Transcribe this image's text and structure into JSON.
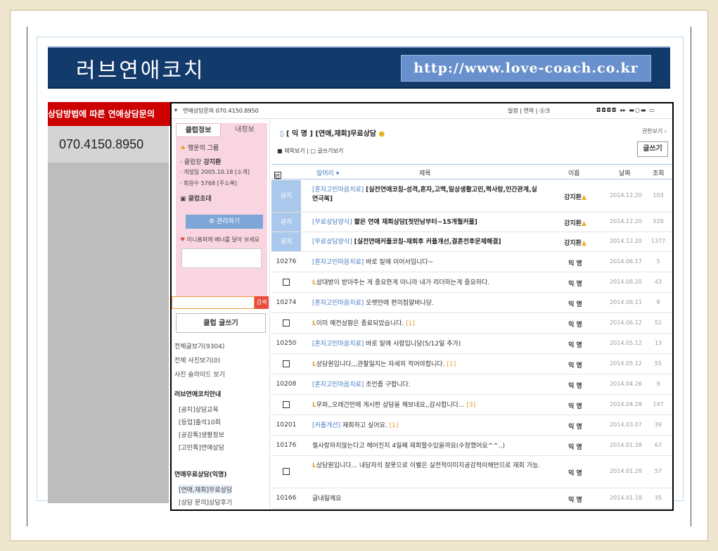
{
  "banner": {
    "title": "러브연애코치",
    "url": "http://www.love-coach.co.kr"
  },
  "left_panel": {
    "red_text": "상담방법에 따른 연애상담문의",
    "phone": "070.4150.8950"
  },
  "topbar": {
    "title": "연애상담문의 070.4150.8950",
    "links": "일정 | 연락 | ⓖ크"
  },
  "sidebar": {
    "tab_info": "클럽정보",
    "tab_mine": "내정보",
    "grade": "행운의 그룹",
    "master_label": "· 클럽장",
    "master_name": "강지환",
    "open_date": "· 개설일   2005.10.18 [소개]",
    "members": "· 회원수   5768 [주소록]",
    "invite": "클럽초대",
    "manage": "⚙ 관리하기",
    "mini_banner": "미니홈피에 배너를 달아 보세요",
    "search_btn": "검색",
    "write_btn": "클럽 글쓰기",
    "all_posts": "전체글보기(9304)",
    "all_photos": "전체 사진보기(0)",
    "slide": "사진 슬라이드 보기",
    "section1": "러브연애코치안내",
    "section1_items": [
      "[공지]상담교육",
      "[등업]출석10회",
      "[공감톡]생활정보",
      "[고민톡]연애상담"
    ],
    "section2": "연애무료상담(익명)",
    "section2_items": [
      "[연애,재회]무료상담",
      "[상담 문의]상담후기"
    ]
  },
  "board": {
    "title": "[ 익 명 ] [연애,재회]무료상담",
    "permission": "권한보기 ›",
    "view_opts": "■ 제목보기 | □ 글쓰기보기",
    "write": "글쓰기",
    "headers": {
      "num": "번호",
      "head": "말머리 ▾",
      "subject": "제목",
      "name": "이름",
      "date": "날짜",
      "count": "조회"
    },
    "rows": [
      {
        "num": "공지",
        "cat": "[혼자고민마음치료]",
        "subj": "[실전연애코칭-성격,혼자,고백,일상생활고민,짝사랑,인간관계,실연극복]",
        "bold": true,
        "name": "강지환",
        "date": "2014.12.20",
        "count": "103",
        "h": 46
      },
      {
        "num": "공지",
        "cat": "[무료상담양식]",
        "subj": "짧은 연애 재회상담[첫만남부터~15개월커플]",
        "bold": true,
        "name": "강지환",
        "date": "2014.12.20",
        "count": "520",
        "h": 28
      },
      {
        "num": "공지",
        "cat": "[무료상담양식]",
        "subj": "[실전연애커플코칭-재회후 커플개선,결혼전후문제해결]",
        "bold": true,
        "name": "강지환",
        "date": "2014.12.20",
        "count": "1377",
        "h": 28
      },
      {
        "num": "10276",
        "cat": "[혼자고민마음치료]",
        "subj": "바로 밑에 이어서입니다~",
        "name": "익 명",
        "date": "2014.06.17",
        "count": "5",
        "h": 29
      },
      {
        "num": "",
        "reply": true,
        "subj": "상대방이 받아주는 게 중요한게 아니라 내가 리더하는게 중요하다.",
        "name": "익 명",
        "date": "2014.06.20",
        "count": "43",
        "h": 29
      },
      {
        "num": "10274",
        "cat": "[혼자고민마음치료]",
        "subj": "오랫만에 편의점알바나당.",
        "name": "익 명",
        "date": "2014.06.11",
        "count": "8",
        "h": 29
      },
      {
        "num": "",
        "reply": true,
        "subj": "이미 예전상황은 종료되었습니다.",
        "comments": "[1]",
        "name": "익 명",
        "date": "2014.06.12",
        "count": "52",
        "h": 29
      },
      {
        "num": "10250",
        "cat": "[혼자고민마음치료]",
        "subj": "바로 밑에 사람입니당(5/12일 추가)",
        "name": "익 명",
        "date": "2014.05.12",
        "count": "13",
        "h": 29
      },
      {
        "num": "",
        "reply": true,
        "subj": "상담원입니다,,,관찰일지는 자세히 적어야합니다.",
        "comments": "[1]",
        "name": "익 명",
        "date": "2014.05.12",
        "count": "55",
        "h": 29
      },
      {
        "num": "10208",
        "cat": "[혼자고민마음치료]",
        "subj": "조언좀 구합니다.",
        "name": "익 명",
        "date": "2014.04.26",
        "count": "9",
        "h": 29
      },
      {
        "num": "",
        "reply": true,
        "subj": "우와,,오래간만에 게시판 상담을 해보네요,,감사합니다...",
        "comments": "[3]",
        "name": "익 명",
        "date": "2014.04.28",
        "count": "147",
        "h": 29
      },
      {
        "num": "10201",
        "cat": "[커플개선]",
        "subj": "재회하고 싶어요.",
        "comments": "[1]",
        "name": "익 명",
        "date": "2014.03.07",
        "count": "39",
        "h": 29
      },
      {
        "num": "10176",
        "cat": "",
        "subj": "절사랑하지않는다고 헤어진지 4일째 재회할수있을까요(수정했어요^^..)",
        "name": "익 명",
        "date": "2014.01.28",
        "count": "67",
        "h": 29
      },
      {
        "num": "",
        "reply": true,
        "subj": "상담원입니다... 내담자의 잘못으로 이별은 실전적이미지공감적이해만으로 재회 가능.",
        "name": "익 명",
        "date": "2014.01.28",
        "count": "57",
        "h": 46
      },
      {
        "num": "10166",
        "cat": "",
        "subj": "글내릴께요",
        "name": "익 명",
        "date": "2014.01.18",
        "count": "35",
        "h": 29
      }
    ]
  }
}
